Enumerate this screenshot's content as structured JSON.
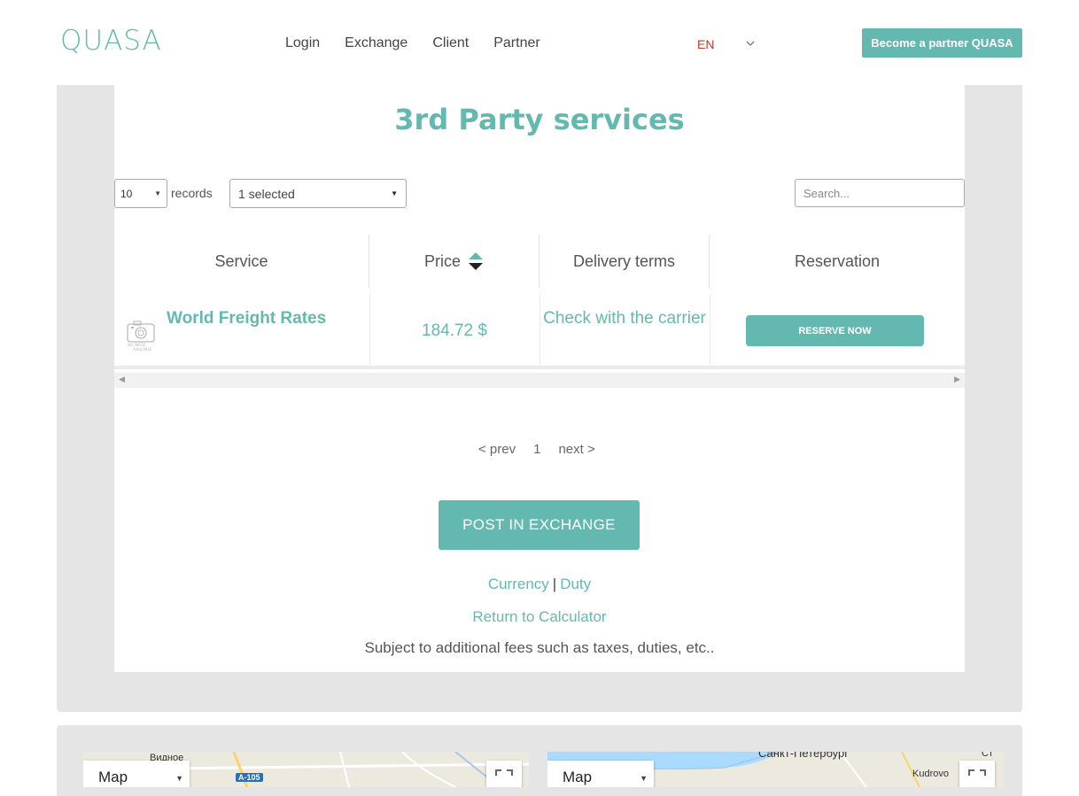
{
  "header": {
    "logo_text": "QUASA",
    "nav": [
      "Login",
      "Exchange",
      "Client",
      "Partner"
    ],
    "language": "EN",
    "partner_button": "Become a partner QUASA"
  },
  "page": {
    "title": "3rd Party services"
  },
  "controls": {
    "records_value": "10",
    "records_label": "records",
    "filter_value": "1 selected",
    "search_placeholder": "Search..."
  },
  "table": {
    "headers": {
      "service": "Service",
      "price": "Price",
      "delivery": "Delivery terms",
      "reservation": "Reservation"
    },
    "rows": [
      {
        "service": "World Freight Rates",
        "image_text": "NO IMAGE AVAILABLE",
        "price": "184.72 $",
        "delivery": "Check with the carrier",
        "reserve_label": "RESERVE NOW"
      }
    ]
  },
  "pager": {
    "prev": "< prev",
    "current": "1",
    "next": "next >"
  },
  "actions": {
    "post_button": "POST IN EXCHANGE",
    "currency_link": "Currency",
    "separator": "|",
    "duty_link": "Duty",
    "return_link": "Return to Calculator",
    "note": "Subject to additional fees such as taxes, duties, etc.."
  },
  "maps": {
    "left": {
      "type_label": "Map",
      "place": "Видное",
      "road": "A-105"
    },
    "right": {
      "type_label": "Map",
      "place": "Санкт-Петербург",
      "place2": "Kudrovo",
      "place3": "Ст"
    }
  },
  "colors": {
    "accent": "#63b9b0",
    "language": "#c0392b",
    "panel": "#e5e5e5"
  }
}
